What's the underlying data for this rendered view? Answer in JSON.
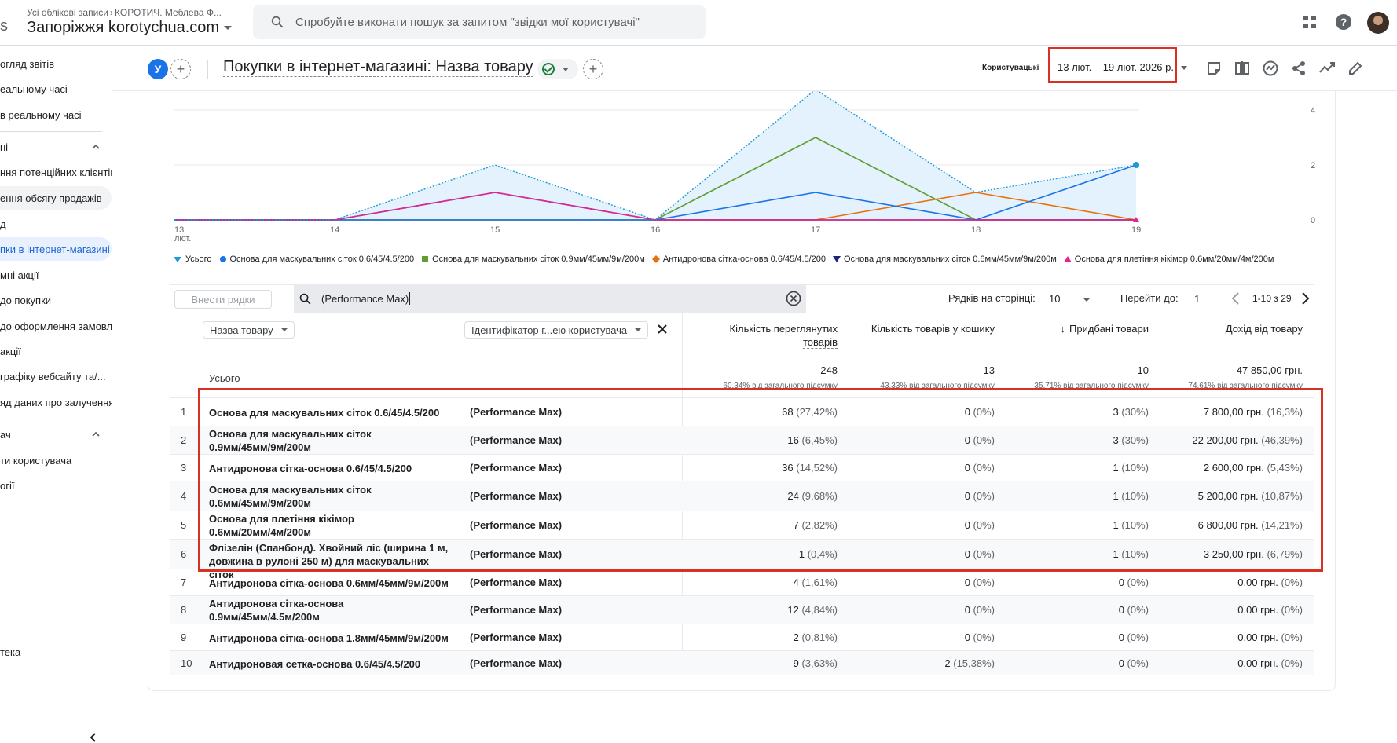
{
  "header": {
    "breadcrumb_accounts": "Усі облікові записи",
    "breadcrumb_account": "КОРОТИЧ. Меблева Ф...",
    "property": "Запоріжжя korotychua.com",
    "left_clip": "s",
    "search_placeholder": "Спробуйте виконати пошук за запитом \"звідки мої користувачі\""
  },
  "sidebar": {
    "items": [
      {
        "label": "огляд звітів"
      },
      {
        "label": "еальному часі"
      },
      {
        "label": "в реальному часі"
      },
      {
        "label": "ні"
      },
      {
        "label": "ння потенційних клієнтів"
      },
      {
        "label": "ення обсягу продажів"
      },
      {
        "label": "д"
      },
      {
        "label": "пки в інтернет-магазині"
      },
      {
        "label": "мні акції"
      },
      {
        "label": "до покупки"
      },
      {
        "label": "до оформлення замовлення"
      },
      {
        "label": "акції"
      },
      {
        "label": "графіку вебсайту та/..."
      },
      {
        "label": "яд даних про залучення"
      },
      {
        "label": "ач"
      },
      {
        "label": "ти користувача"
      },
      {
        "label": "огії"
      },
      {
        "label": "тека"
      }
    ]
  },
  "report": {
    "segment_badge": "У",
    "title": "Покупки в інтернет-магазині: Назва товару",
    "date_prefix": "Користувацькі",
    "date_range": "13 лют. – 19 лют. 2026 р."
  },
  "chart_data": {
    "type": "line",
    "x": [
      "13 лют.",
      "14",
      "15",
      "16",
      "17",
      "18",
      "19"
    ],
    "y_ticks": [
      "4",
      "2",
      "0"
    ],
    "ylim": [
      0,
      4
    ],
    "series": [
      {
        "name": "Усього",
        "color": "#1a9ad6",
        "values": [
          0,
          0,
          2,
          0,
          5,
          1,
          2
        ]
      },
      {
        "name": "Основа для маскувальних сіток 0.6/45/4.5/200",
        "color": "#1a73e8",
        "values": [
          0,
          0,
          0,
          0,
          1,
          0,
          2
        ]
      },
      {
        "name": "Основа для маскувальних сіток 0.9мм/45мм/9м/200м",
        "color": "#5f9e2f",
        "values": [
          0,
          0,
          0,
          0,
          3,
          0,
          0
        ]
      },
      {
        "name": "Антидронова сітка-основа 0.6/45/4.5/200",
        "color": "#e8710a",
        "values": [
          0,
          0,
          0,
          0,
          0,
          1,
          0
        ]
      },
      {
        "name": "Основа для маскувальних сіток 0.6мм/45мм/9м/200м",
        "color": "#1a237e",
        "values": [
          0,
          0,
          1,
          0,
          0,
          0,
          0
        ]
      },
      {
        "name": "Основа для плетіння кікімор 0.6мм/20мм/4м/200м",
        "color": "#e52592",
        "values": [
          0,
          0,
          1,
          0,
          0,
          0,
          0
        ]
      }
    ]
  },
  "table_controls": {
    "add_rows": "Внести рядки",
    "search_value": "(Performance Max)",
    "rows_per_page_label": "Рядків на сторінці:",
    "rows_per_page": "10",
    "goto_label": "Перейти до:",
    "goto_value": "1",
    "page_info": "1-10 з 29"
  },
  "table": {
    "dim1": "Назва товару",
    "dim2": "Ідентифікатор г...ею користувача",
    "metric_headers": [
      "Кількість переглянутих товарів",
      "Кількість товарів у кошику",
      "Придбані товари",
      "Дохід від товару"
    ],
    "total_label": "Усього",
    "totals": [
      {
        "value": "248",
        "pct": "60,34% від загального підсумку"
      },
      {
        "value": "13",
        "pct": "43,33% від загального підсумку"
      },
      {
        "value": "10",
        "pct": "35,71% від загального підсумку"
      },
      {
        "value": "47 850,00 грн.",
        "pct": "74,61% від загального підсумку"
      }
    ],
    "rows": [
      {
        "idx": "1",
        "name": "Основа для маскувальних сіток 0.6/45/4.5/200",
        "camp": "(Performance Max)",
        "v1": "68",
        "p1": "(27,42%)",
        "v2": "0",
        "p2": "(0%)",
        "v3": "3",
        "p3": "(30%)",
        "v4": "7 800,00 грн.",
        "p4": "(16,3%)"
      },
      {
        "idx": "2",
        "name": "Основа для маскувальних сіток 0.9мм/45мм/9м/200м",
        "camp": "(Performance Max)",
        "v1": "16",
        "p1": "(6,45%)",
        "v2": "0",
        "p2": "(0%)",
        "v3": "3",
        "p3": "(30%)",
        "v4": "22 200,00 грн.",
        "p4": "(46,39%)"
      },
      {
        "idx": "3",
        "name": "Антидронова сітка-основа 0.6/45/4.5/200",
        "camp": "(Performance Max)",
        "v1": "36",
        "p1": "(14,52%)",
        "v2": "0",
        "p2": "(0%)",
        "v3": "1",
        "p3": "(10%)",
        "v4": "2 600,00 грн.",
        "p4": "(5,43%)"
      },
      {
        "idx": "4",
        "name": "Основа для маскувальних сіток 0.6мм/45мм/9м/200м",
        "camp": "(Performance Max)",
        "v1": "24",
        "p1": "(9,68%)",
        "v2": "0",
        "p2": "(0%)",
        "v3": "1",
        "p3": "(10%)",
        "v4": "5 200,00 грн.",
        "p4": "(10,87%)"
      },
      {
        "idx": "5",
        "name": "Основа для плетіння кікімор 0.6мм/20мм/4м/200м",
        "camp": "(Performance Max)",
        "v1": "7",
        "p1": "(2,82%)",
        "v2": "0",
        "p2": "(0%)",
        "v3": "1",
        "p3": "(10%)",
        "v4": "6 800,00 грн.",
        "p4": "(14,21%)"
      },
      {
        "idx": "6",
        "name": "Флізелін (Спанбонд). Хвойний ліс (ширина 1 м, довжина в рулоні 250 м) для маскувальних сіток",
        "camp": "(Performance Max)",
        "v1": "1",
        "p1": "(0,4%)",
        "v2": "0",
        "p2": "(0%)",
        "v3": "1",
        "p3": "(10%)",
        "v4": "3 250,00 грн.",
        "p4": "(6,79%)"
      },
      {
        "idx": "7",
        "name": "Антидронова сітка-основа 0.6мм/45мм/9м/200м",
        "camp": "(Performance Max)",
        "v1": "4",
        "p1": "(1,61%)",
        "v2": "0",
        "p2": "(0%)",
        "v3": "0",
        "p3": "(0%)",
        "v4": "0,00 грн.",
        "p4": "(0%)"
      },
      {
        "idx": "8",
        "name": "Антидронова сітка-основа 0.9мм/45мм/4.5м/200м",
        "camp": "(Performance Max)",
        "v1": "12",
        "p1": "(4,84%)",
        "v2": "0",
        "p2": "(0%)",
        "v3": "0",
        "p3": "(0%)",
        "v4": "0,00 грн.",
        "p4": "(0%)"
      },
      {
        "idx": "9",
        "name": "Антидронова сітка-основа 1.8мм/45мм/9м/200м",
        "camp": "(Performance Max)",
        "v1": "2",
        "p1": "(0,81%)",
        "v2": "0",
        "p2": "(0%)",
        "v3": "0",
        "p3": "(0%)",
        "v4": "0,00 грн.",
        "p4": "(0%)"
      },
      {
        "idx": "10",
        "name": "Антидроновая сетка-основа 0.6/45/4.5/200",
        "camp": "(Performance Max)",
        "v1": "9",
        "p1": "(3,63%)",
        "v2": "2",
        "p2": "(15,38%)",
        "v3": "0",
        "p3": "(0%)",
        "v4": "0,00 грн.",
        "p4": "(0%)"
      }
    ]
  }
}
